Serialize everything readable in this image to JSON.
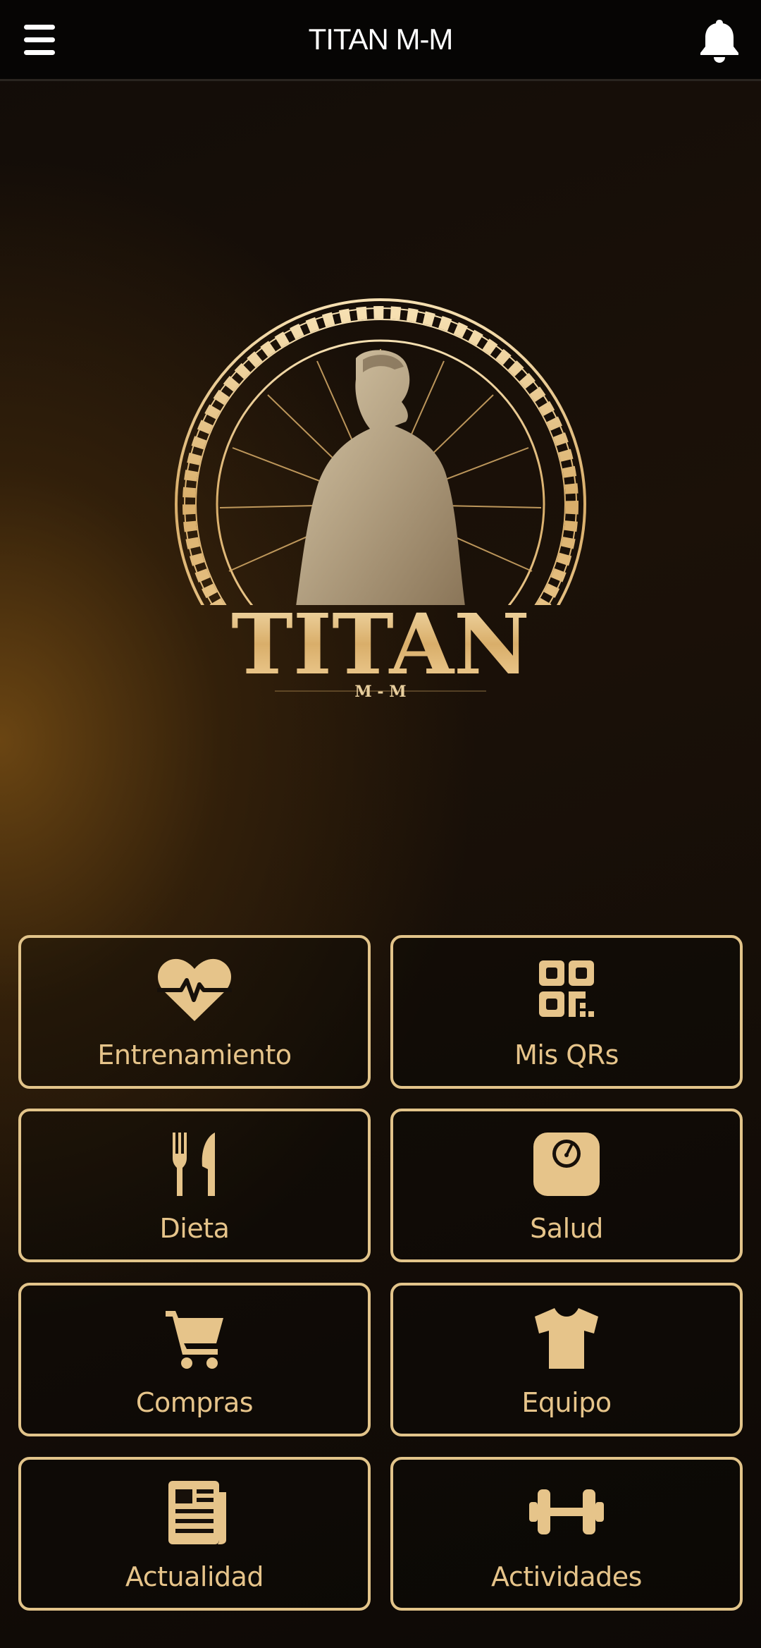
{
  "header": {
    "title": "TITAN M-M"
  },
  "logo": {
    "wordmark": "TITAN",
    "subtitle": "M - M"
  },
  "tiles": [
    {
      "label": "Entrenamiento",
      "icon": "heartbeat-icon"
    },
    {
      "label": "Mis QRs",
      "icon": "qr-code-icon"
    },
    {
      "label": "Dieta",
      "icon": "utensils-icon"
    },
    {
      "label": "Salud",
      "icon": "scale-icon"
    },
    {
      "label": "Compras",
      "icon": "cart-icon"
    },
    {
      "label": "Equipo",
      "icon": "tshirt-icon"
    },
    {
      "label": "Actualidad",
      "icon": "newspaper-icon"
    },
    {
      "label": "Actividades",
      "icon": "dumbbell-icon"
    }
  ],
  "colors": {
    "accent": "#e2c48a",
    "header_bg": "#060504",
    "header_text": "#ffffff"
  }
}
